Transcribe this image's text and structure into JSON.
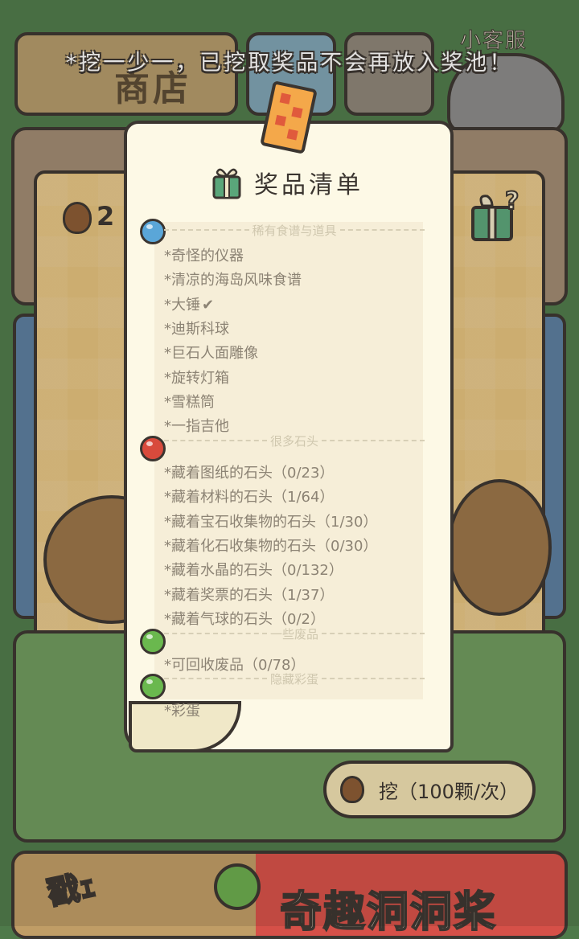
{
  "header": {
    "tip": "*挖一少一，已挖取奖品不会再放入奖池！",
    "shop_label": "商店",
    "customer_service_label": "小客服"
  },
  "counter": {
    "value": "2"
  },
  "modal": {
    "title": "奖品清单",
    "sections": [
      {
        "label": "稀有食谱与道具",
        "dot_color": "#5aa6d8",
        "items": [
          {
            "text": "*奇怪的仪器"
          },
          {
            "text": "*清凉的海岛风味食谱"
          },
          {
            "text": "*大锤",
            "checked": true
          },
          {
            "text": "*迪斯科球"
          },
          {
            "text": "*巨石人面雕像"
          },
          {
            "text": "*旋转灯箱"
          },
          {
            "text": "*雪糕筒"
          },
          {
            "text": "*一指吉他"
          }
        ]
      },
      {
        "label": "很多石头",
        "dot_color": "#d84a3c",
        "items": [
          {
            "text": "*藏着图纸的石头（0/23）"
          },
          {
            "text": "*藏着材料的石头（1/64）"
          },
          {
            "text": "*藏着宝石收集物的石头（1/30）"
          },
          {
            "text": "*藏着化石收集物的石头（0/30）"
          },
          {
            "text": "*藏着水晶的石头（0/132）"
          },
          {
            "text": "*藏着奖票的石头（1/37）"
          },
          {
            "text": "*藏着气球的石头（0/2）"
          }
        ]
      },
      {
        "label": "一些废品",
        "dot_color": "#6ab84e",
        "items": [
          {
            "text": "*可回收废品（0/78）"
          }
        ]
      },
      {
        "label": "隐藏彩蛋",
        "dot_color": "#6ab84e",
        "items": [
          {
            "text": "*彩蛋"
          }
        ]
      }
    ]
  },
  "dig_button": {
    "label": "挖（100颗/次）"
  },
  "bottom_banner": {
    "left_text": "戳ｪ",
    "right_text": "奇趣洞洞桨"
  },
  "icons": {
    "gift": "gift-icon",
    "acorn": "acorn-icon",
    "mystery_gift": "mystery-gift-icon",
    "ticket": "ticket-icon",
    "check": "check-icon"
  }
}
